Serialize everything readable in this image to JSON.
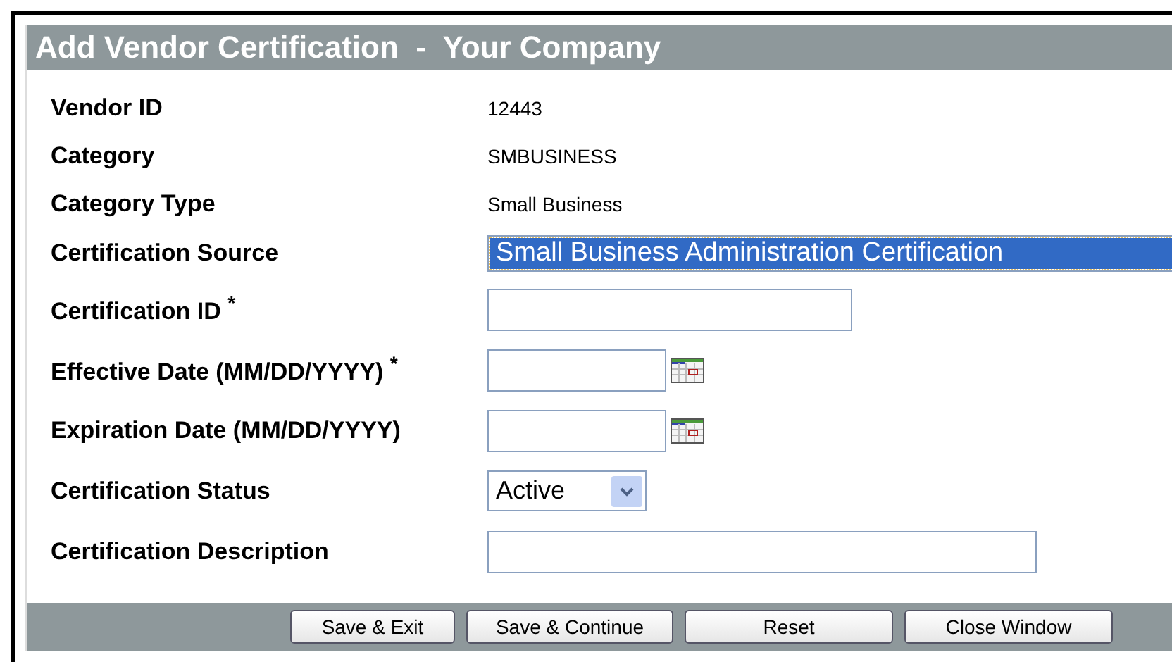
{
  "title": "Add Vendor Certification  -  Your Company",
  "fields": [
    {
      "kind": "text",
      "label": "Vendor ID",
      "value": "12443"
    },
    {
      "kind": "text",
      "label": "Category",
      "value": "SMBUSINESS"
    },
    {
      "kind": "text",
      "label": "Category Type",
      "value": "Small Business"
    },
    {
      "kind": "listbox",
      "label": "Certification Source",
      "value": "Small Business Administration Certification",
      "selected": true
    },
    {
      "kind": "short-input",
      "label": "Certification ID $^{*}$"
    },
    {
      "kind": "date",
      "label": "Effective Date (MM/DD/YYYY) $^{*}$"
    },
    {
      "kind": "date",
      "label": "Expiration Date (MM/DD/YYYY)"
    },
    {
      "kind": "select",
      "label": "Certification Status",
      "value": "Active"
    },
    {
      "kind": "long-input",
      "label": "Certification Description"
    }
  ],
  "buttons": [
    "Save & Exit",
    "Save & Continue",
    "Reset",
    "Close Window"
  ]
}
